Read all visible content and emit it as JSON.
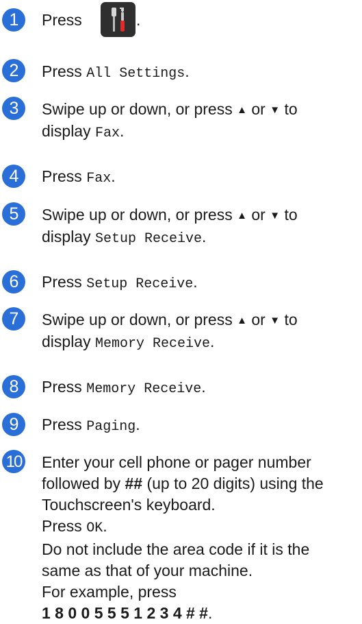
{
  "accent_color": "#2a6ed8",
  "steps": [
    {
      "number": "1",
      "press": "Press",
      "icon": "settings-tools-icon",
      "period": "."
    },
    {
      "number": "2",
      "press": "Press",
      "option": "All Settings",
      "period": "."
    },
    {
      "number": "3",
      "line1": "Swipe up or down, or press",
      "up": "▲",
      "or": "or",
      "down": "▼",
      "to": "to",
      "display": "display",
      "option": "Fax",
      "period": "."
    },
    {
      "number": "4",
      "press": "Press",
      "option": "Fax",
      "period": "."
    },
    {
      "number": "5",
      "line1": "Swipe up or down, or press",
      "up": "▲",
      "or": "or",
      "down": "▼",
      "to": "to",
      "display": "display",
      "option": "Setup Receive",
      "period": "."
    },
    {
      "number": "6",
      "press": "Press",
      "option": "Setup Receive",
      "period": "."
    },
    {
      "number": "7",
      "line1": "Swipe up or down, or press",
      "up": "▲",
      "or": "or",
      "down": "▼",
      "to": "to",
      "display": "display",
      "option": "Memory Receive",
      "period": "."
    },
    {
      "number": "8",
      "press": "Press",
      "option": "Memory Receive",
      "period": "."
    },
    {
      "number": "9",
      "press": "Press",
      "option": "Paging",
      "period": "."
    },
    {
      "number": "10",
      "line1": "Enter your cell phone or pager number",
      "line2_a": "followed by",
      "line2_bold": "##",
      "line2_b": "(up to 20 digits) using the",
      "line3": "Touchscreen's keyboard.",
      "press": "Press",
      "option": "OK",
      "period": ".",
      "line5": "Do not include the area code if it is the",
      "line6": "same as that of your machine.",
      "line7": "For example, press",
      "example": "1 8 0 0 5 5 5 1 2 3 4 # #",
      "example_period": "."
    }
  ]
}
